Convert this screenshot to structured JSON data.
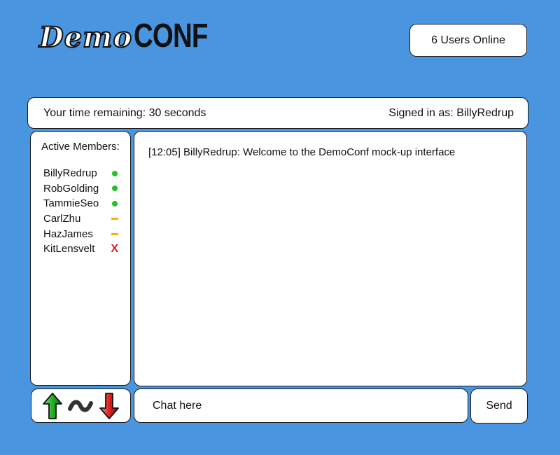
{
  "logo": {
    "demo": "Demo",
    "conf": "CONF"
  },
  "users_online": "6 Users Online",
  "status": {
    "time_remaining": "Your time remaining: 30 seconds",
    "signed_in": "Signed in as: BillyRedrup"
  },
  "members": {
    "heading": "Active Members:",
    "list": [
      {
        "name": "BillyRedrup",
        "status": "online"
      },
      {
        "name": "RobGolding",
        "status": "online"
      },
      {
        "name": "TammieSeo",
        "status": "online"
      },
      {
        "name": "CarlZhu",
        "status": "away"
      },
      {
        "name": "HazJames",
        "status": "away"
      },
      {
        "name": "KitLensvelt",
        "status": "offline"
      }
    ],
    "status_colors": {
      "online": "#22c322",
      "away": "#f0b400",
      "offline": "#e01c1c"
    },
    "offline_mark": "X"
  },
  "chat": {
    "messages": [
      {
        "text": "[12:05] BillyRedrup: Welcome to the DemoConf mock-up interface"
      }
    ],
    "input_placeholder": "Chat here",
    "send_label": "Send"
  },
  "controls": {
    "up_icon": "green-up-arrow-icon",
    "wave_icon": "tilde-wave-icon",
    "down_icon": "red-down-arrow-icon"
  },
  "colors": {
    "background": "#4a95df",
    "panel": "#ffffff"
  }
}
